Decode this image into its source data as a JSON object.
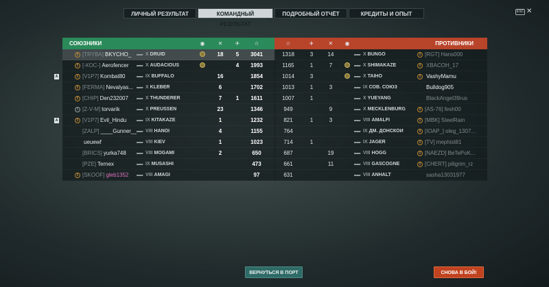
{
  "tabs": [
    "ЛИЧНЫЙ РЕЗУЛЬТАТ",
    "КОМАНДНЫЙ РЕЗУЛЬТАТ",
    "ПОДРОБНЫЙ ОТЧЁТ",
    "КРЕДИТЫ И ОПЫТ"
  ],
  "esc_label": "ESC",
  "close_glyph": "✕",
  "allies": {
    "title": "СОЮЗНИКИ",
    "header_icons": {
      "medal": "medal-icon",
      "kills": "crossed-swords-icon",
      "planes": "plane-icon",
      "xp": "star-icon"
    },
    "rows": [
      {
        "clan": "[TRYBA]",
        "name": "BKYCHO_",
        "tier": "X",
        "ship": "DRUID",
        "medal": true,
        "kills": "18",
        "planes": "5",
        "xp": "3041",
        "highlight": true,
        "badge": "circle"
      },
      {
        "clan": "[-КОС-]",
        "name": "Aerofencer",
        "tier": "X",
        "ship": "AUDACIOUS",
        "medal": true,
        "kills": "",
        "planes": "4",
        "xp": "1993",
        "badge": "circle"
      },
      {
        "clan": "[V1P7]",
        "name": "Kombat80",
        "tier": "IX",
        "ship": "BUFFALO",
        "medal": false,
        "kills": "16",
        "planes": "",
        "xp": "1854",
        "badge": "circle",
        "division": "A"
      },
      {
        "clan": "[FERMA]",
        "name": "Nevalyas...",
        "tier": "X",
        "ship": "KLÉBER",
        "medal": false,
        "kills": "6",
        "planes": "",
        "xp": "1702",
        "badge": "circle"
      },
      {
        "clan": "[CHIP]",
        "name": "Den232007",
        "tier": "X",
        "ship": "THUNDERER",
        "medal": false,
        "kills": "7",
        "planes": "1",
        "xp": "1611",
        "badge": "circle"
      },
      {
        "clan": "[Z-V-M]",
        "name": "torvarik",
        "tier": "X",
        "ship": "PREUSSEN",
        "medal": false,
        "kills": "23",
        "planes": "",
        "xp": "1346",
        "badge": "gray"
      },
      {
        "clan": "[V1P7]",
        "name": "Evil_Hindu",
        "tier": "IX",
        "ship": "KITAKAZE",
        "medal": false,
        "kills": "1",
        "planes": "",
        "xp": "1232",
        "badge": "circle",
        "division": "A"
      },
      {
        "clan": "[ZALP]",
        "name": "____Gunner___",
        "tier": "VIII",
        "ship": "HANOI",
        "medal": false,
        "kills": "4",
        "planes": "",
        "xp": "1155",
        "badge": ""
      },
      {
        "clan": "",
        "name": "ueuewf",
        "tier": "VIII",
        "ship": "KIEV",
        "medal": false,
        "kills": "1",
        "planes": "",
        "xp": "1023",
        "badge": ""
      },
      {
        "clan": "[BRICS]",
        "name": "yurka748",
        "tier": "VIII",
        "ship": "MOGAMI",
        "medal": false,
        "kills": "2",
        "planes": "",
        "xp": "650",
        "badge": ""
      },
      {
        "clan": "[PZE]",
        "name": "Ternex",
        "tier": "IX",
        "ship": "MUSASHI",
        "medal": false,
        "kills": "",
        "planes": "",
        "xp": "473",
        "badge": ""
      },
      {
        "clan": "[SKOOF]",
        "name": "gleb1352",
        "tier": "VIII",
        "ship": "AMAGI",
        "medal": false,
        "kills": "",
        "planes": "",
        "xp": "97",
        "badge": "circle",
        "pink": true
      }
    ]
  },
  "enemies": {
    "title": "ПРОТИВНИКИ",
    "header_icons": {
      "xp": "star-icon",
      "planes": "plane-icon",
      "kills": "crossed-swords-icon",
      "medal": "medal-icon"
    },
    "rows": [
      {
        "xp": "1318",
        "planes": "3",
        "kills": "14",
        "medal": false,
        "tier": "X",
        "ship": "BUNGO",
        "clan": "[RGT]",
        "name": "Hans000",
        "badge": "circle"
      },
      {
        "xp": "1165",
        "planes": "1",
        "kills": "7",
        "medal": true,
        "tier": "X",
        "ship": "SHIMAKAZE",
        "clan": "",
        "name": "XBACOH_17",
        "badge": "circle"
      },
      {
        "xp": "1014",
        "planes": "3",
        "kills": "",
        "medal": true,
        "tier": "X",
        "ship": "TAIHŌ",
        "clan": "",
        "name": "VashyMamu",
        "badge": "circle",
        "bright": true
      },
      {
        "xp": "1013",
        "planes": "1",
        "kills": "3",
        "medal": false,
        "tier": "IX",
        "ship": "СОВ. СОЮЗ",
        "clan": "",
        "name": "Bulldog905",
        "badge": "",
        "bright": true
      },
      {
        "xp": "1007",
        "planes": "1",
        "kills": "",
        "medal": false,
        "tier": "X",
        "ship": "YUEYANG",
        "clan": "",
        "name": "BlackAngel39rus",
        "badge": ""
      },
      {
        "xp": "949",
        "planes": "",
        "kills": "9",
        "medal": false,
        "tier": "X",
        "ship": "MECKLENBURG",
        "clan": "[AS-76]",
        "name": "fesh00",
        "badge": "circle"
      },
      {
        "xp": "821",
        "planes": "1",
        "kills": "3",
        "medal": false,
        "tier": "VIII",
        "ship": "AMALFI",
        "clan": "[MBK]",
        "name": "SteelRain",
        "badge": "circle"
      },
      {
        "xp": "764",
        "planes": "",
        "kills": "",
        "medal": false,
        "tier": "IX",
        "ship": "ДМ. ДОНСКОЙ",
        "clan": "[IOAP_]",
        "name": "oleg_1307...",
        "badge": "circle"
      },
      {
        "xp": "714",
        "planes": "1",
        "kills": "",
        "medal": false,
        "tier": "IX",
        "ship": "JÄGER",
        "clan": "[TV]",
        "name": "mephist81",
        "badge": "circle"
      },
      {
        "xp": "687",
        "planes": "",
        "kills": "19",
        "medal": false,
        "tier": "VIII",
        "ship": "HOGG",
        "clan": "[NAEZD]",
        "name": "BeTePoK...",
        "badge": "circle"
      },
      {
        "xp": "661",
        "planes": "",
        "kills": "11",
        "medal": false,
        "tier": "VIII",
        "ship": "GASCOGNE",
        "clan": "[CHERT]",
        "name": "piligrim_rz",
        "badge": "circle"
      },
      {
        "xp": "631",
        "planes": "",
        "kills": "",
        "medal": false,
        "tier": "VIII",
        "ship": "ANHALT",
        "clan": "",
        "name": "sasha13031977",
        "badge": ""
      }
    ]
  },
  "buttons": {
    "port": "ВЕРНУТЬСЯ В ПОРТ",
    "battle": "СНОВА В БОЙ!"
  },
  "colors": {
    "allies_header": "#2a8a5a",
    "enemies_header": "#b8442a",
    "port_button": "#2f6b66",
    "battle_button": "#c0421f"
  }
}
